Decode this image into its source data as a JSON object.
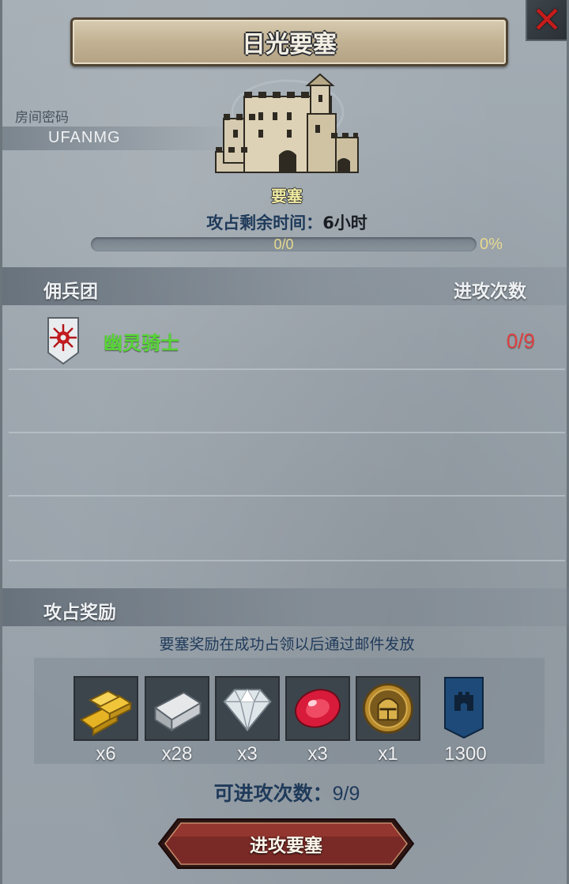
{
  "header": {
    "title": "日光要塞",
    "close_icon": "close-x-icon"
  },
  "room": {
    "label": "房间密码",
    "code": "UFANMG"
  },
  "fortress": {
    "type_label": "要塞",
    "time_label": "攻占剩余时间：",
    "time_value": "6小时",
    "progress_text": "0/0",
    "progress_percent": "0%",
    "progress_fraction": 0
  },
  "guild_section": {
    "title": "佣兵团",
    "count_header": "进攻次数",
    "rows": [
      {
        "name": "幽灵骑士",
        "count": "0/9",
        "crest_icon": "sun-crest-icon"
      }
    ]
  },
  "reward_section": {
    "title": "攻占奖励",
    "note": "要塞奖励在成功占领以后通过邮件发放",
    "items": [
      {
        "icon": "gold-bars-icon",
        "count": "x6"
      },
      {
        "icon": "silver-ingot-icon",
        "count": "x28"
      },
      {
        "icon": "diamond-icon",
        "count": "x3"
      },
      {
        "icon": "ruby-icon",
        "count": "x3"
      },
      {
        "icon": "knight-medal-icon",
        "count": "x1"
      },
      {
        "icon": "castle-banner-icon",
        "count": "1300"
      }
    ]
  },
  "attacks": {
    "label": "可进攻次数：",
    "value": "9/9"
  },
  "action": {
    "attack_label": "进攻要塞"
  },
  "colors": {
    "guild_name": "#58d437",
    "guild_count": "#e04141",
    "fort_label": "#efe9a0",
    "button": "#7a2a26"
  }
}
